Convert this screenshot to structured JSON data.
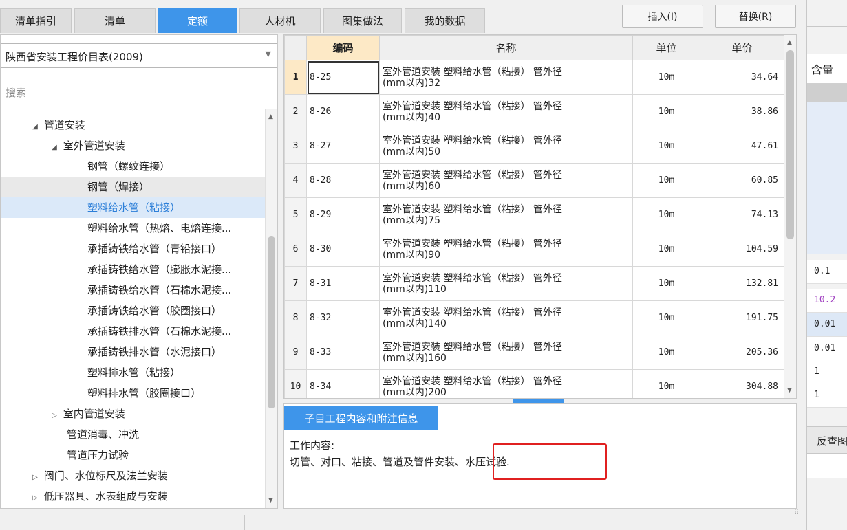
{
  "tabs": [
    {
      "label": "清单指引"
    },
    {
      "label": "清单"
    },
    {
      "label": "定额"
    },
    {
      "label": "人材机"
    },
    {
      "label": "图集做法"
    },
    {
      "label": "我的数据"
    }
  ],
  "buttons": {
    "insert": "插入(I)",
    "replace": "替换(R)"
  },
  "library_select": {
    "value": "陕西省安装工程价目表(2009)"
  },
  "search": {
    "placeholder": "搜索"
  },
  "tree": [
    {
      "label": "管道安装",
      "toggle": "◢"
    },
    {
      "label": "室外管道安装",
      "toggle": "◢"
    },
    {
      "label": "钢管（螺纹连接）",
      "toggle": ""
    },
    {
      "label": "钢管（焊接）",
      "toggle": ""
    },
    {
      "label": "塑料给水管（粘接）",
      "toggle": ""
    },
    {
      "label": "塑料给水管（热熔、电熔连接...",
      "toggle": ""
    },
    {
      "label": "承插铸铁给水管（青铅接口）",
      "toggle": ""
    },
    {
      "label": "承插铸铁给水管（膨胀水泥接...",
      "toggle": ""
    },
    {
      "label": "承插铸铁给水管（石棉水泥接...",
      "toggle": ""
    },
    {
      "label": "承插铸铁给水管（胶圈接口）",
      "toggle": ""
    },
    {
      "label": "承插铸铁排水管（石棉水泥接...",
      "toggle": ""
    },
    {
      "label": "承插铸铁排水管（水泥接口）",
      "toggle": ""
    },
    {
      "label": "塑料排水管（粘接）",
      "toggle": ""
    },
    {
      "label": "塑料排水管（胶圈接口）",
      "toggle": ""
    },
    {
      "label": "室内管道安装",
      "toggle": "▷"
    },
    {
      "label": "管道消毒、冲洗",
      "toggle": ""
    },
    {
      "label": "管道压力试验",
      "toggle": ""
    },
    {
      "label": "阀门、水位标尺及法兰安装",
      "toggle": "▷"
    },
    {
      "label": "低压器具、水表组成与安装",
      "toggle": "▷"
    }
  ],
  "table": {
    "headers": {
      "code": "编码",
      "name": "名称",
      "unit": "单位",
      "price": "单价"
    },
    "rows": [
      {
        "idx": "1",
        "code": "8-25",
        "name1": "室外管道安装 塑料给水管（粘接） 管外径",
        "name2": "(mm以内)32",
        "unit": "10m",
        "price": "34.64"
      },
      {
        "idx": "2",
        "code": "8-26",
        "name1": "室外管道安装 塑料给水管（粘接） 管外径",
        "name2": "(mm以内)40",
        "unit": "10m",
        "price": "38.86"
      },
      {
        "idx": "3",
        "code": "8-27",
        "name1": "室外管道安装 塑料给水管（粘接） 管外径",
        "name2": "(mm以内)50",
        "unit": "10m",
        "price": "47.61"
      },
      {
        "idx": "4",
        "code": "8-28",
        "name1": "室外管道安装 塑料给水管（粘接） 管外径",
        "name2": "(mm以内)60",
        "unit": "10m",
        "price": "60.85"
      },
      {
        "idx": "5",
        "code": "8-29",
        "name1": "室外管道安装 塑料给水管（粘接） 管外径",
        "name2": "(mm以内)75",
        "unit": "10m",
        "price": "74.13"
      },
      {
        "idx": "6",
        "code": "8-30",
        "name1": "室外管道安装 塑料给水管（粘接） 管外径",
        "name2": "(mm以内)90",
        "unit": "10m",
        "price": "104.59"
      },
      {
        "idx": "7",
        "code": "8-31",
        "name1": "室外管道安装 塑料给水管（粘接） 管外径",
        "name2": "(mm以内)110",
        "unit": "10m",
        "price": "132.81"
      },
      {
        "idx": "8",
        "code": "8-32",
        "name1": "室外管道安装 塑料给水管（粘接） 管外径",
        "name2": "(mm以内)140",
        "unit": "10m",
        "price": "191.75"
      },
      {
        "idx": "9",
        "code": "8-33",
        "name1": "室外管道安装 塑料给水管（粘接） 管外径",
        "name2": "(mm以内)160",
        "unit": "10m",
        "price": "205.36"
      },
      {
        "idx": "10",
        "code": "8-34",
        "name1": "室外管道安装 塑料给水管（粘接） 管外径",
        "name2": "(mm以内)200",
        "unit": "10m",
        "price": "304.88"
      }
    ]
  },
  "info": {
    "tab": "子目工程内容和附注信息",
    "heading": "工作内容:",
    "content": "切管、对口、粘接、管道及管件安装、水压试验."
  },
  "background": {
    "header": "含量",
    "values": [
      "0.1",
      "10.2",
      "0.01",
      "0.01",
      "1",
      "1"
    ],
    "fancha": "反查图"
  },
  "colors": {
    "accent": "#3e95ea",
    "highlight_box": "#e02020",
    "header_code_bg": "#fde9c6"
  }
}
